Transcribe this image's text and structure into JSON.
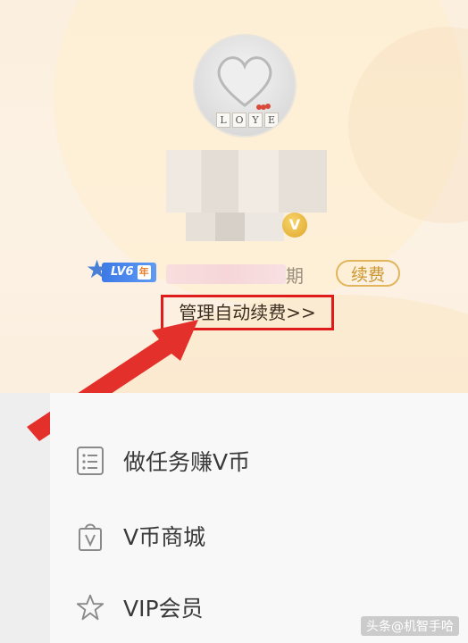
{
  "profile": {
    "avatar_tiles": [
      "L",
      "O",
      "Y",
      "E"
    ],
    "vip_coin": "V",
    "level_badge": {
      "level": "LV6",
      "year": "年"
    },
    "expire_suffix": "期",
    "renew_label": "续费",
    "manage_renew_label": "管理自动续费>>"
  },
  "menu": {
    "items": [
      {
        "label": "做任务赚V币",
        "icon": "task-list-icon"
      },
      {
        "label": "V币商城",
        "icon": "shopping-bag-icon"
      },
      {
        "label": "VIP会员",
        "icon": "star-icon"
      }
    ]
  },
  "watermark": "头条@机智手哈",
  "colors": {
    "highlight_border": "#e01b1b",
    "arrow": "#e4302b",
    "renew_gold": "#e2b45b",
    "level_blue": "#3d79e6"
  }
}
